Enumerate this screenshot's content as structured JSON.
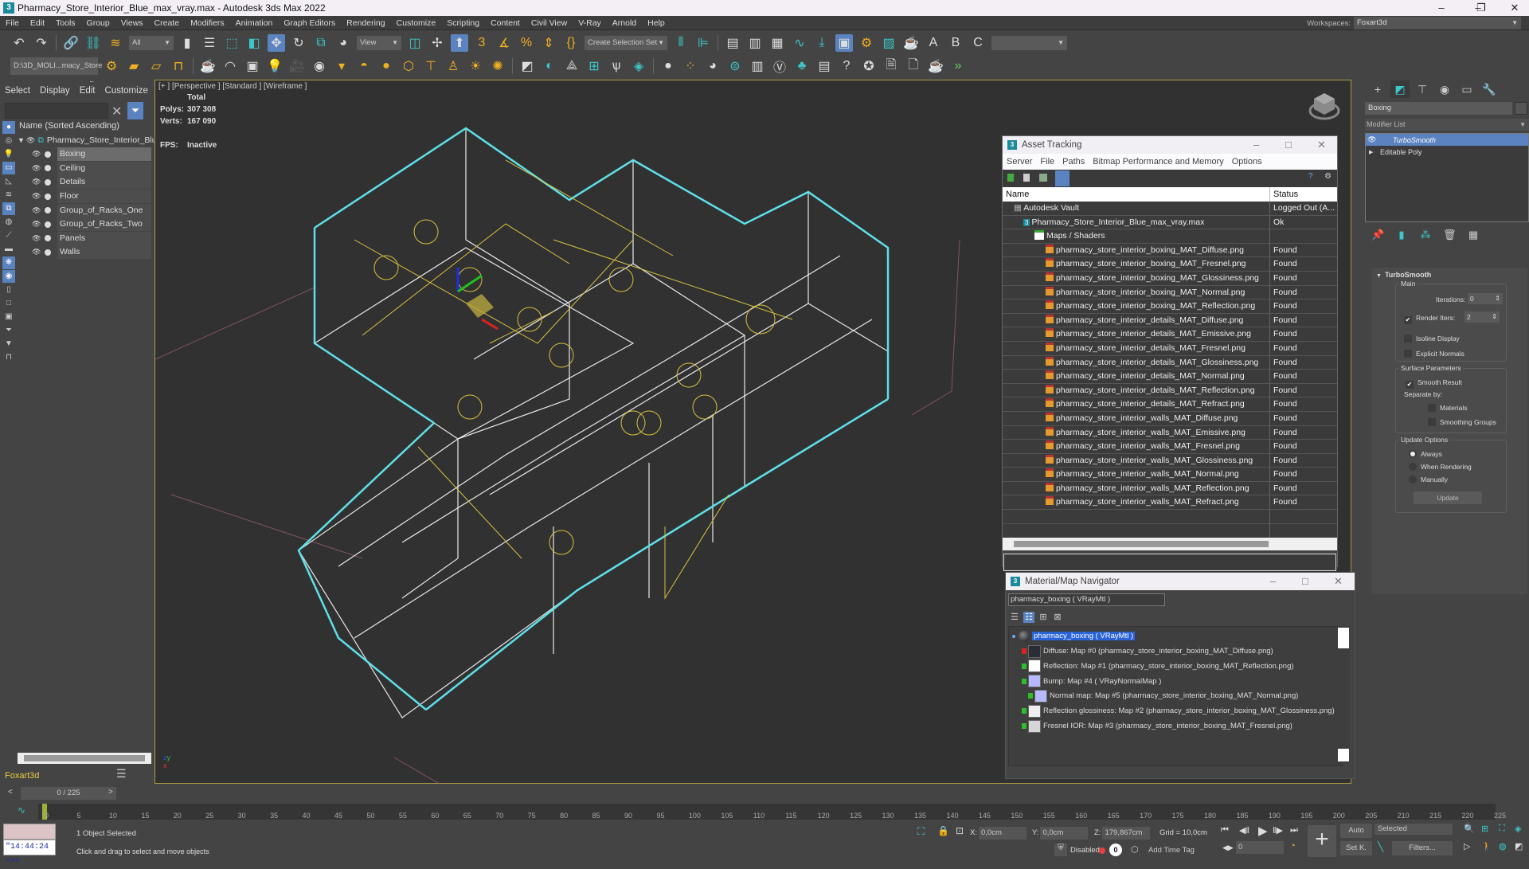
{
  "window": {
    "title": "Pharmacy_Store_Interior_Blue_max_vray.max - Autodesk 3ds Max 2022",
    "logo": "3",
    "controls": [
      "minimize-icon",
      "restore-icon",
      "close-icon"
    ]
  },
  "menubar": {
    "items": [
      "File",
      "Edit",
      "Tools",
      "Group",
      "Views",
      "Create",
      "Modifiers",
      "Animation",
      "Graph Editors",
      "Rendering",
      "Customize",
      "Scripting",
      "Content",
      "Civil View",
      "V-Ray",
      "Arnold",
      "Help"
    ],
    "workspaces_label": "Workspaces:",
    "workspace_value": "Foxart3d"
  },
  "toolbar1": {
    "selection_filter": "All",
    "reference_coord": "View",
    "selection_set_placeholder": "Create Selection Set",
    "icons": [
      "undo-icon",
      "redo-icon",
      "link-icon",
      "unlink-icon",
      "bind-space-warp-icon",
      "select-object-icon",
      "select-by-name-icon",
      "rect-selection-icon",
      "window-crossing-icon",
      "move-icon",
      "rotate-icon",
      "scale-icon",
      "place-icon",
      "mirror-icon",
      "align-icon",
      "toggle-ribbon-icon",
      "snaps-3d-icon",
      "angle-snap-icon",
      "percent-snap-icon",
      "spinner-snap-icon",
      "edit-named-sel-icon",
      "mirror-tool-icon",
      "align-tool-icon",
      "layer-explorer-icon",
      "scene-explorer-icon",
      "toggle-ribbon-icon",
      "curve-editor-icon",
      "schematic-view-icon",
      "material-editor-icon",
      "render-setup-icon",
      "rendered-frame-icon",
      "render-icon",
      "arnold-a-icon",
      "arnold-b-icon",
      "arnold-c-icon"
    ]
  },
  "toolbar2": {
    "project_path": "D:\\3D_MOLI...macy_Store"
  },
  "explorer": {
    "menu": [
      "Select",
      "Display",
      "Edit",
      "Customize"
    ],
    "search_value": "",
    "column_header": "Name (Sorted Ascending)",
    "root": "Pharmacy_Store_Interior_Blue",
    "items": [
      {
        "label": "Boxing",
        "selected": true
      },
      {
        "label": "Ceiling",
        "selected": false
      },
      {
        "label": "Details",
        "selected": false
      },
      {
        "label": "Floor",
        "selected": false
      },
      {
        "label": "Group_of_Racks_One",
        "selected": false
      },
      {
        "label": "Group_of_Racks_Two",
        "selected": false
      },
      {
        "label": "Panels",
        "selected": false
      },
      {
        "label": "Walls",
        "selected": false
      }
    ],
    "layer": "Foxart3d"
  },
  "viewport": {
    "label": "[+ ] [Perspective ]  [Standard ]  [Wireframe ]",
    "stats_header": "Total",
    "polys_label": "Polys:",
    "polys_value": "307 308",
    "verts_label": "Verts:",
    "verts_value": "167 090",
    "fps_label": "FPS:",
    "fps_value": "Inactive",
    "axis_x": "x",
    "axis_y": "y",
    "axis_z": "z"
  },
  "asset_tracking": {
    "title": "Asset Tracking",
    "menu": [
      "Server",
      "File",
      "Paths",
      "Bitmap Performance and Memory",
      "Options"
    ],
    "col_name": "Name",
    "col_status": "Status",
    "vault": {
      "name": "Autodesk Vault",
      "status": "Logged Out (A..."
    },
    "file": {
      "name": "Pharmacy_Store_Interior_Blue_max_vray.max",
      "status": "Ok"
    },
    "maps_folder": "Maps / Shaders",
    "maps": [
      {
        "name": "pharmacy_store_interior_boxing_MAT_Diffuse.png",
        "status": "Found"
      },
      {
        "name": "pharmacy_store_interior_boxing_MAT_Fresnel.png",
        "status": "Found"
      },
      {
        "name": "pharmacy_store_interior_boxing_MAT_Glossiness.png",
        "status": "Found"
      },
      {
        "name": "pharmacy_store_interior_boxing_MAT_Normal.png",
        "status": "Found"
      },
      {
        "name": "pharmacy_store_interior_boxing_MAT_Reflection.png",
        "status": "Found"
      },
      {
        "name": "pharmacy_store_interior_details_MAT_Diffuse.png",
        "status": "Found"
      },
      {
        "name": "pharmacy_store_interior_details_MAT_Emissive.png",
        "status": "Found"
      },
      {
        "name": "pharmacy_store_interior_details_MAT_Fresnel.png",
        "status": "Found"
      },
      {
        "name": "pharmacy_store_interior_details_MAT_Glossiness.png",
        "status": "Found"
      },
      {
        "name": "pharmacy_store_interior_details_MAT_Normal.png",
        "status": "Found"
      },
      {
        "name": "pharmacy_store_interior_details_MAT_Reflection.png",
        "status": "Found"
      },
      {
        "name": "pharmacy_store_interior_details_MAT_Refract.png",
        "status": "Found"
      },
      {
        "name": "pharmacy_store_interior_walls_MAT_Diffuse.png",
        "status": "Found"
      },
      {
        "name": "pharmacy_store_interior_walls_MAT_Emissive.png",
        "status": "Found"
      },
      {
        "name": "pharmacy_store_interior_walls_MAT_Fresnel.png",
        "status": "Found"
      },
      {
        "name": "pharmacy_store_interior_walls_MAT_Glossiness.png",
        "status": "Found"
      },
      {
        "name": "pharmacy_store_interior_walls_MAT_Normal.png",
        "status": "Found"
      },
      {
        "name": "pharmacy_store_interior_walls_MAT_Reflection.png",
        "status": "Found"
      },
      {
        "name": "pharmacy_store_interior_walls_MAT_Refract.png",
        "status": "Found"
      }
    ]
  },
  "material_navigator": {
    "title": "Material/Map Navigator",
    "current": "pharmacy_boxing  ( VRayMtl )",
    "root": "pharmacy_boxing  ( VRayMtl )",
    "nodes": [
      {
        "label": "Diffuse: Map #0 (pharmacy_store_interior_boxing_MAT_Diffuse.png)",
        "swatch": "#2a2d35",
        "pin": "#e02020",
        "indent": 0
      },
      {
        "label": "Reflection: Map #1 (pharmacy_store_interior_boxing_MAT_Reflection.png)",
        "swatch": "#ffffff",
        "pin": "#2cc02c",
        "indent": 0
      },
      {
        "label": "Bump: Map #4  ( VRayNormalMap )",
        "swatch": "#b8b8ff",
        "pin": "#2cc02c",
        "indent": 0
      },
      {
        "label": "Normal map: Map #5 (pharmacy_store_interior_boxing_MAT_Normal.png)",
        "swatch": "#b8b8ff",
        "pin": "#2cc02c",
        "indent": 1
      },
      {
        "label": "Reflection glossiness: Map #2 (pharmacy_store_interior_boxing_MAT_Glossiness.png)",
        "swatch": "#eeeeee",
        "pin": "#2cc02c",
        "indent": 0
      },
      {
        "label": "Fresnel IOR: Map #3 (pharmacy_store_interior_boxing_MAT_Fresnel.png)",
        "swatch": "#d6d6d6",
        "pin": "#2cc02c",
        "indent": 0
      }
    ]
  },
  "command_panel": {
    "object_name": "Boxing",
    "modifier_list": "Modifier List",
    "stack": [
      {
        "label": "TurboSmooth",
        "selected": true
      },
      {
        "label": "Editable Poly",
        "selected": false
      }
    ],
    "rollout_title": "TurboSmooth",
    "main_label": "Main",
    "iterations_label": "Iterations:",
    "iterations_value": "0",
    "render_iters_label": "Render Iters:",
    "render_iters_value": "2",
    "render_iters_checked": true,
    "isoline_label": "Isoline Display",
    "explicit_normals_label": "Explicit Normals",
    "surface_label": "Surface Parameters",
    "smooth_result_label": "Smooth Result",
    "separate_by_label": "Separate by:",
    "materials_label": "Materials",
    "smoothing_groups_label": "Smoothing Groups",
    "update_options_label": "Update Options",
    "always_label": "Always",
    "when_rendering_label": "When Rendering",
    "manually_label": "Manually",
    "update_button": "Update"
  },
  "timeline": {
    "frame_counter": "0 / 225",
    "current_frame": 0,
    "total_frames": 225,
    "ticks": [
      "0",
      "5",
      "10",
      "15",
      "20",
      "25",
      "30",
      "35",
      "40",
      "45",
      "50",
      "55",
      "60",
      "65",
      "70",
      "75",
      "80",
      "85",
      "90",
      "95",
      "100",
      "105",
      "110",
      "115",
      "120",
      "125",
      "130",
      "135",
      "140",
      "145",
      "150",
      "155",
      "160",
      "165",
      "170",
      "175",
      "180",
      "185",
      "190",
      "195",
      "200",
      "205",
      "210",
      "215",
      "220",
      "225"
    ]
  },
  "statusbar": {
    "maxscript_value": "\"14:44:24 >>>",
    "selection_status": "1 Object Selected",
    "prompt": "Click and drag to select and move objects",
    "x_label": "X:",
    "x_value": "0,0cm",
    "y_label": "Y:",
    "y_value": "0,0cm",
    "z_label": "Z:",
    "z_value": "179,867cm",
    "grid": "Grid = 10,0cm",
    "disabled_label": "Disabled:",
    "disabled_count": "0",
    "add_time_tag": "Add Time Tag",
    "frame_field": "0",
    "auto_button": "Auto",
    "setkey_button": "Set K.",
    "key_filter_value": "Selected",
    "filters_button": "Filters..."
  }
}
